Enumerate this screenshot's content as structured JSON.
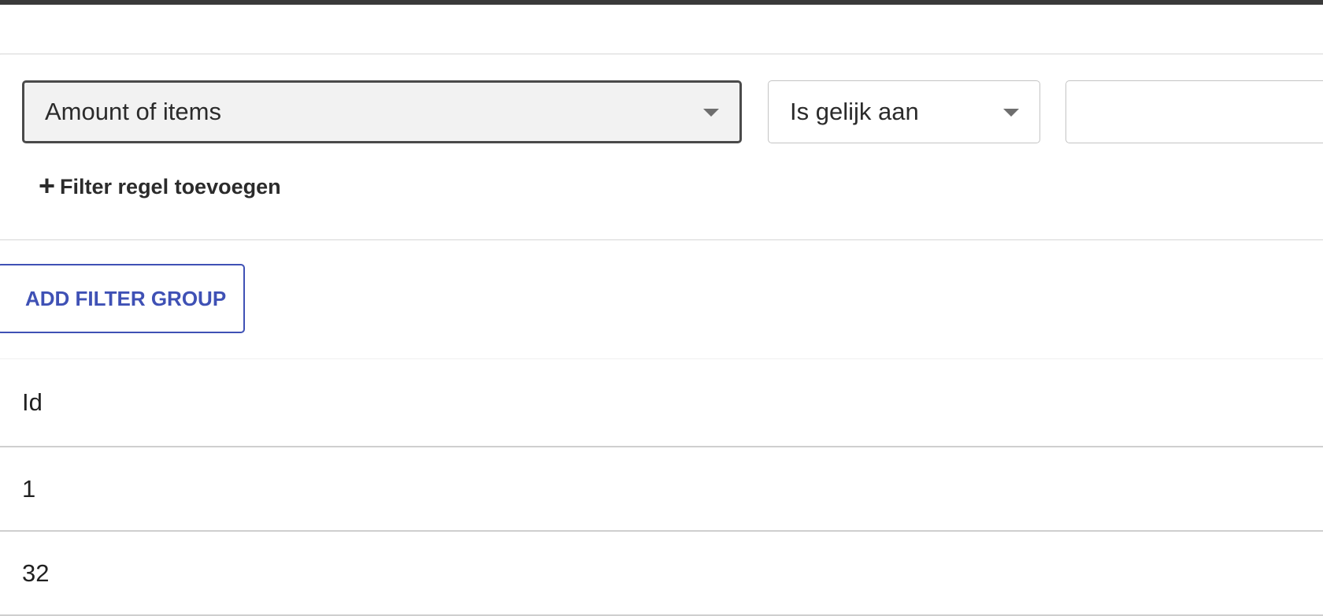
{
  "filter": {
    "field": "Amount of items",
    "operator": "Is gelijk aan",
    "value": "",
    "add_rule_label": "Filter regel toevoegen"
  },
  "add_group_label": "ADD FILTER GROUP",
  "table": {
    "columns": [
      "Id"
    ],
    "rows": [
      [
        "1"
      ],
      [
        "32"
      ]
    ]
  },
  "colors": {
    "accent": "#3f51b5",
    "top_bar": "#3a3a3a"
  },
  "icons": {
    "add_rule": "plus-icon",
    "dropdown": "chevron-down-icon"
  }
}
